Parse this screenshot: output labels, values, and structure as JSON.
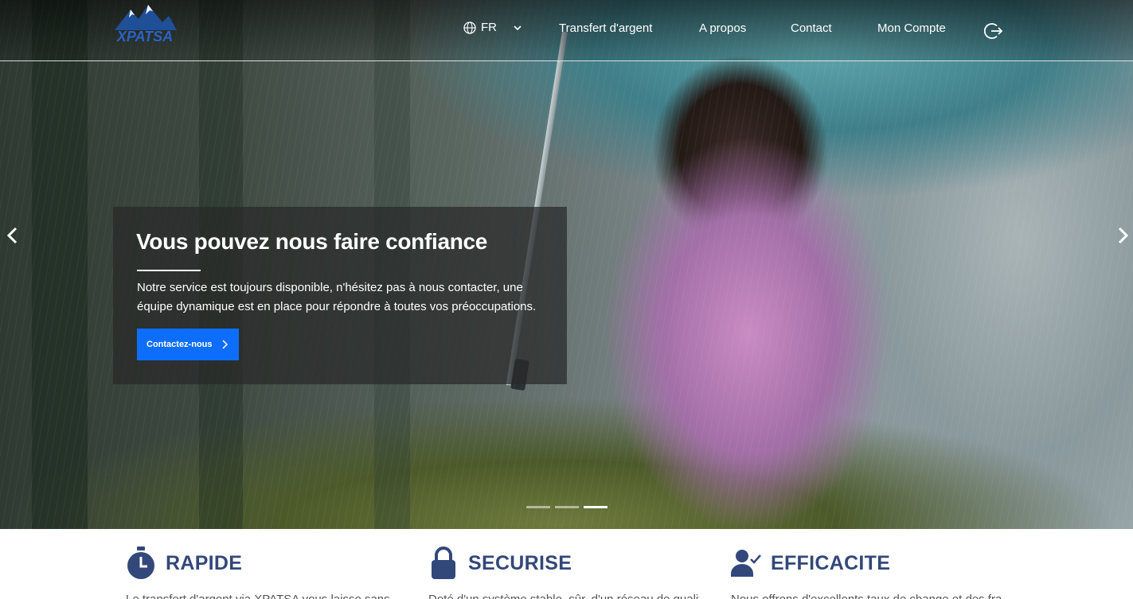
{
  "nav": {
    "logo_text": "XPATSA",
    "language": "FR",
    "links": [
      "Transfert d'argent",
      "A propos",
      "Contact",
      "Mon Compte"
    ]
  },
  "hero": {
    "title": "Vous pouvez nous faire confiance",
    "description": "Notre service est toujours disponible, n'hésitez pas à nous contacter, une équipe dynamique est en place pour répondre à toutes vos préoccupations.",
    "cta_label": "Contactez-nous",
    "slides_count": 3,
    "active_slide": 3
  },
  "features": [
    {
      "icon": "stopwatch-icon",
      "title": "RAPIDE",
      "text": "Le transfert d'argent via XPATSA vous laisse sans"
    },
    {
      "icon": "lock-icon",
      "title": "SECURISE",
      "text": "Doté d'un système stable, sûr, d'un réseau de qualité"
    },
    {
      "icon": "user-check-icon",
      "title": "EFFICACITE",
      "text": "Nous offrons d'excellents taux de change et des frais"
    }
  ],
  "colors": {
    "accent": "#0d6efd",
    "feature_title": "#33487a"
  }
}
